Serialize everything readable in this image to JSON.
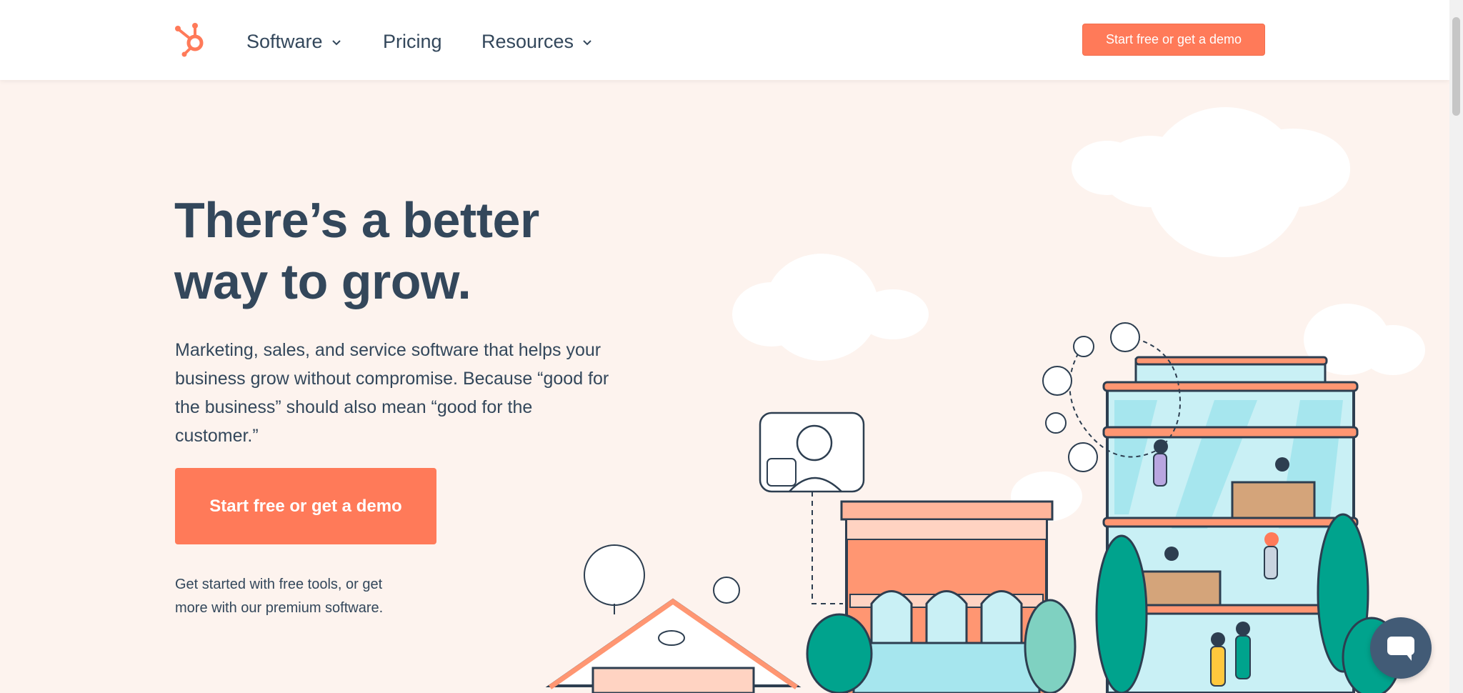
{
  "nav": {
    "items": [
      {
        "label": "Software",
        "has_dropdown": true
      },
      {
        "label": "Pricing",
        "has_dropdown": false
      },
      {
        "label": "Resources",
        "has_dropdown": true
      }
    ],
    "cta_label": "Start free or get a demo"
  },
  "hero": {
    "title_line1": "There’s a better",
    "title_line2": "way to grow.",
    "subtitle": "Marketing, sales, and service software that helps your business grow without compromise. Because “good for the business” should also mean “good for the customer.”",
    "cta_label": "Start free or get a demo",
    "note": "Get started with free tools, or get more with our premium software."
  },
  "colors": {
    "accent": "#ff7a59",
    "text": "#33475b",
    "background": "#fdf3ee",
    "teal": "#00a38d"
  },
  "icons": {
    "logo": "hubspot-sprocket-icon",
    "chevron": "chevron-down-icon",
    "chat": "chat-icon"
  }
}
